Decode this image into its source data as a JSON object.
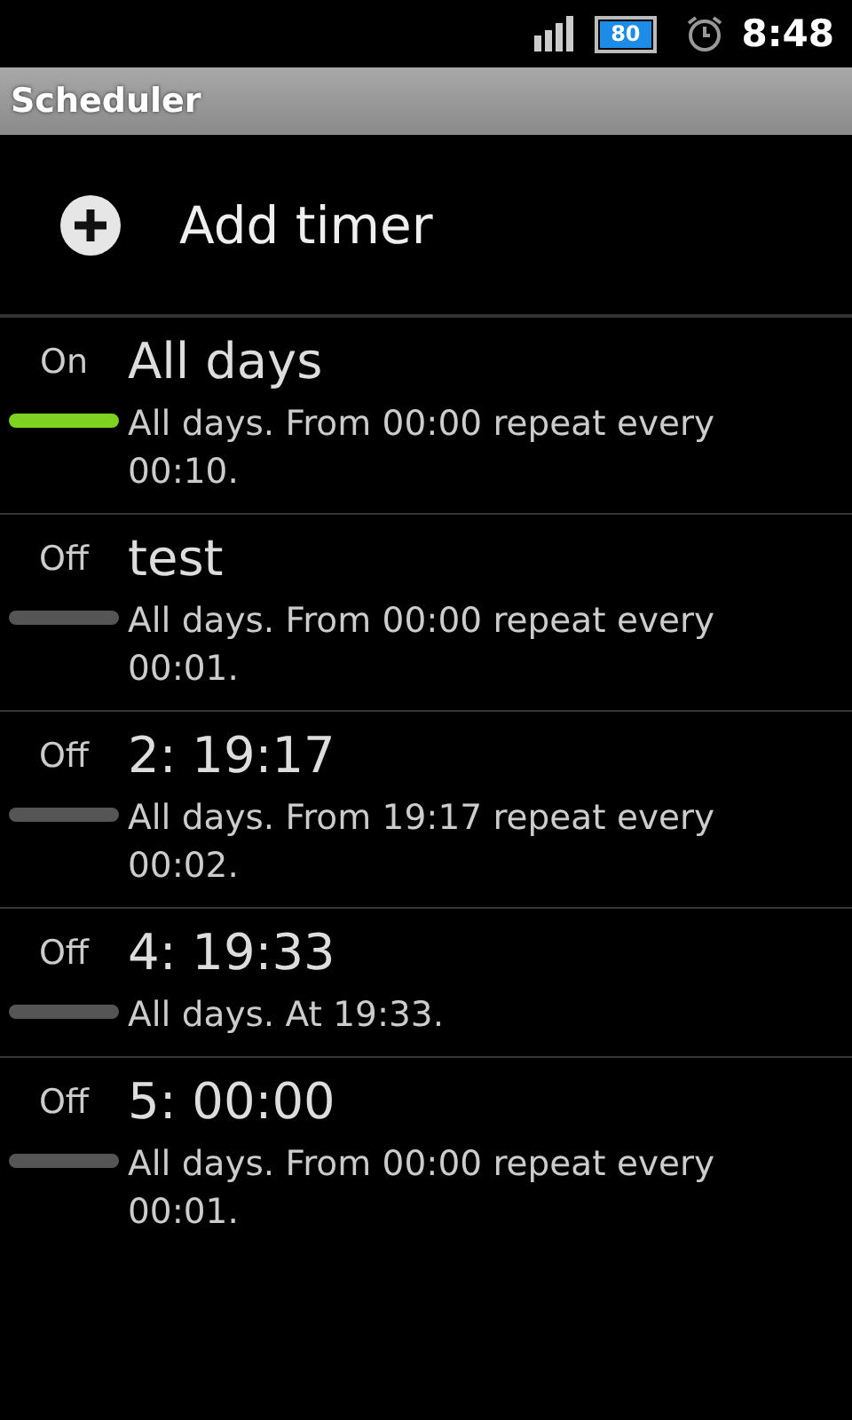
{
  "status_bar": {
    "battery": "80",
    "time": "8:48"
  },
  "window": {
    "title": "Scheduler"
  },
  "add_button": {
    "label": "Add timer"
  },
  "timers": [
    {
      "state_label": "On",
      "on": true,
      "title": "All days",
      "description": "All days. From 00:00 repeat every 00:10."
    },
    {
      "state_label": "Off",
      "on": false,
      "title": "test",
      "description": "All days. From 00:00 repeat every 00:01."
    },
    {
      "state_label": "Off",
      "on": false,
      "title": "2: 19:17",
      "description": "All days. From 19:17 repeat every 00:02."
    },
    {
      "state_label": "Off",
      "on": false,
      "title": "4: 19:33",
      "description": "All days. At 19:33."
    },
    {
      "state_label": "Off",
      "on": false,
      "title": "5: 00:00",
      "description": "All days. From 00:00 repeat every 00:01."
    }
  ]
}
